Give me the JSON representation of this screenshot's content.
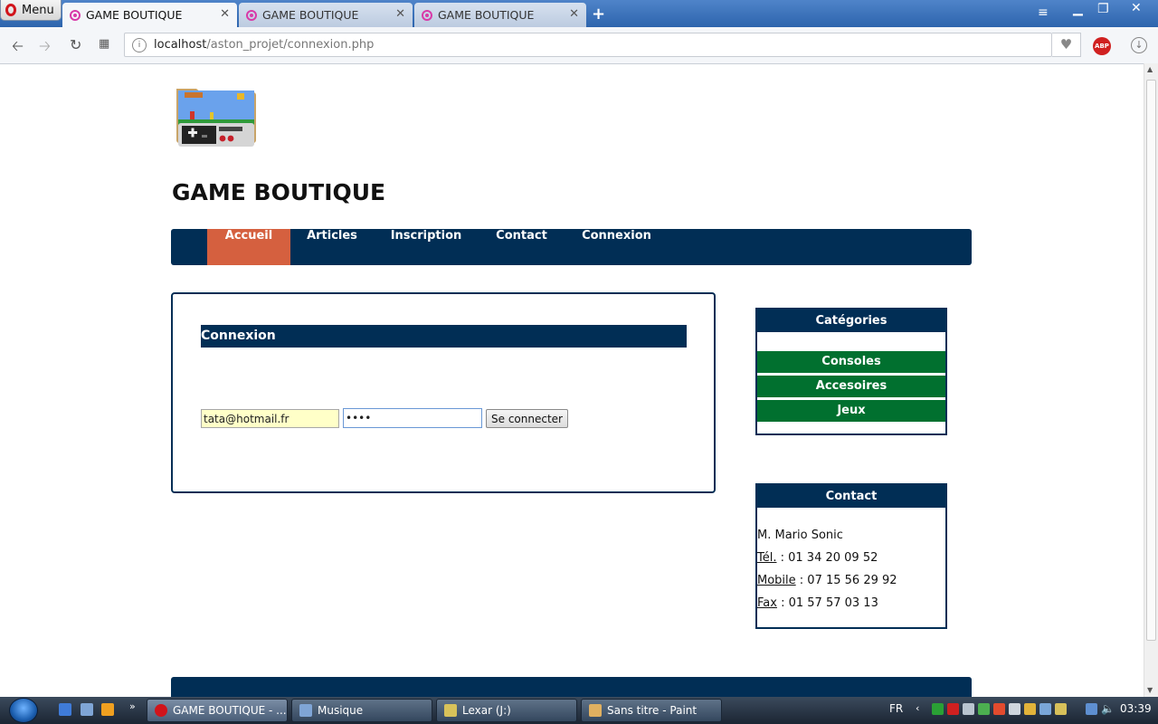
{
  "browser": {
    "menu_label": "Menu",
    "tabs": [
      {
        "title": "GAME BOUTIQUE",
        "active": true
      },
      {
        "title": "GAME BOUTIQUE",
        "active": false
      },
      {
        "title": "GAME BOUTIQUE",
        "active": false
      }
    ],
    "url_host": "localhost",
    "url_path": "/aston_projet/connexion.php",
    "abp_label": "ABP"
  },
  "site": {
    "title": "GAME BOUTIQUE",
    "nav": [
      "Accueil",
      "Articles",
      "Inscription",
      "Contact",
      "Connexion"
    ],
    "active_nav": "Accueil"
  },
  "login": {
    "heading": "Connexion",
    "email_value": "tata@hotmail.fr",
    "password_value": "••••",
    "submit_label": "Se connecter"
  },
  "categories": {
    "heading": "Catégories",
    "items": [
      "Consoles",
      "Accesoires",
      "Jeux"
    ]
  },
  "contact": {
    "heading": "Contact",
    "name": "M. Mario Sonic",
    "tel_label": "Tél.",
    "tel_value": " : 01 34 20 09 52",
    "mobile_label": "Mobile",
    "mobile_value": " : 07 15 56 29 92",
    "fax_label": "Fax",
    "fax_value": " : 01 57 57 03 13"
  },
  "taskbar": {
    "buttons": [
      "GAME BOUTIQUE - ...",
      "Musique",
      "Lexar (J:)",
      "Sans titre - Paint"
    ],
    "language": "FR",
    "clock": "03:39"
  },
  "colors": {
    "navy": "#012e55",
    "nav_active": "#d5603f",
    "category_green": "#01702f",
    "email_autofill": "#ffffc8"
  }
}
